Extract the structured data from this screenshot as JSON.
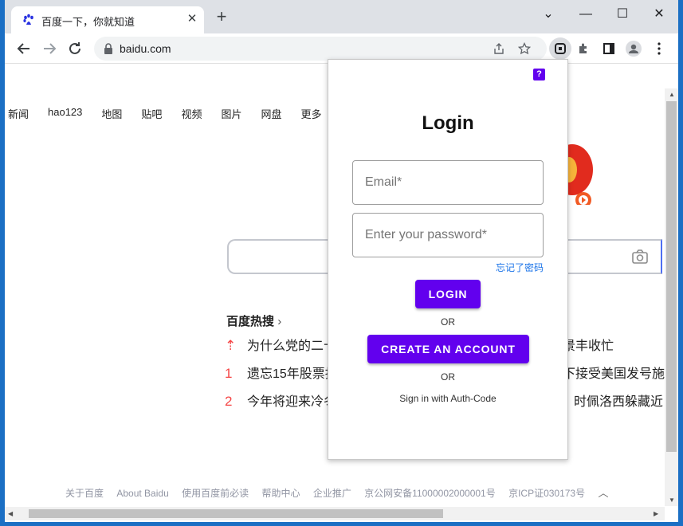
{
  "browser": {
    "tab_title": "百度一下，你就知道",
    "new_tab": "+",
    "url": "baidu.com",
    "close_tab": "✕",
    "win_minimize": "—",
    "win_maximize": "☐",
    "win_close": "✕",
    "win_tab_search": "⌄"
  },
  "baidu": {
    "nav_links": [
      "新闻",
      "hao123",
      "地图",
      "贴吧",
      "视频",
      "图片",
      "网盘",
      "更多"
    ],
    "hot_title": "百度热搜",
    "hot_items": [
      {
        "rank": "⇡",
        "text": "为什么党的二十",
        "tail": "景丰收忙"
      },
      {
        "rank": "1",
        "text": "遗忘15年股票找",
        "tail": "下接受美国发号施"
      },
      {
        "rank": "2",
        "text": "今年将迎来冷冬",
        "tail": "时佩洛西躲藏近"
      }
    ],
    "footer": [
      "关于百度",
      "About Baidu",
      "使用百度前必读",
      "帮助中心",
      "企业推广",
      "京公网安备11000002000001号",
      "京ICP证030173号"
    ]
  },
  "popup": {
    "help": "?",
    "title": "Login",
    "email_placeholder": "Email*",
    "password_placeholder": "Enter your password*",
    "forgot": "忘记了密码",
    "login_label": "LOGIN",
    "or1": "OR",
    "create_label": "CREATE AN ACCOUNT",
    "or2": "OR",
    "authcode": "Sign in with Auth-Code"
  },
  "colors": {
    "accent": "#6200ee",
    "link": "#1a73e8",
    "hot_rank": "#f54545"
  }
}
